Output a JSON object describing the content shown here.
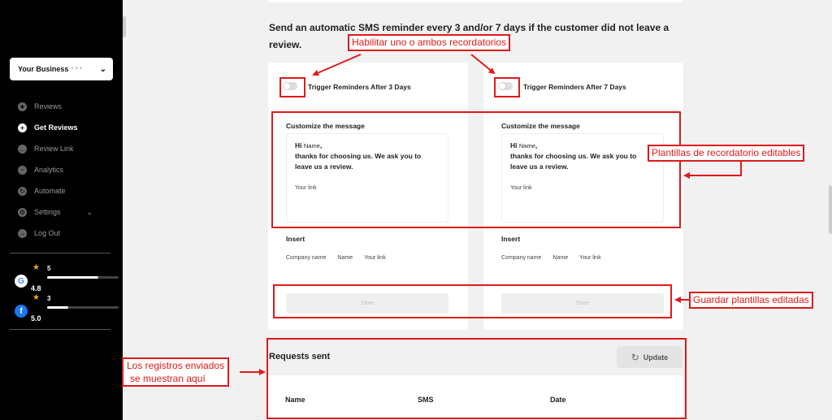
{
  "sidebar": {
    "business_select": {
      "label": "Your Business",
      "masked": "* * *"
    },
    "nav": [
      {
        "label": "Reviews",
        "icon": "star-icon",
        "active": false
      },
      {
        "label": "Get Reviews",
        "icon": "plus-icon",
        "active": true
      },
      {
        "label": "Review Link",
        "icon": "chat-icon",
        "active": false
      },
      {
        "label": "Analytics",
        "icon": "chart-icon",
        "active": false
      },
      {
        "label": "Automate",
        "icon": "automate-icon",
        "active": false
      },
      {
        "label": "Settings",
        "icon": "gear-icon",
        "active": false
      },
      {
        "label": "Log Out",
        "icon": "logout-icon",
        "active": false
      }
    ],
    "ratings": [
      {
        "platform_letter": "G",
        "score": "4.8",
        "count": "5",
        "fill": 0.72
      },
      {
        "platform_letter": "f",
        "score": "5.0",
        "count": "3",
        "fill": 0.3
      }
    ]
  },
  "intro": "Send an automatic SMS reminder every 3 and/or 7 days if the customer did not leave a review.",
  "cards": [
    {
      "toggle_label": "Trigger Reminders After 3 Days",
      "customize_title": "Customize the message",
      "msg_hi": "Hi",
      "msg_name": "Name",
      "msg_body": "thanks for choosing us. We ask you to leave us a review.",
      "msg_link": "Your link",
      "insert_title": "Insert",
      "chips": [
        "Company name",
        "Name",
        "Your link"
      ],
      "save_label": "Save"
    },
    {
      "toggle_label": "Trigger Reminders After 7 Days",
      "customize_title": "Customize the message",
      "msg_hi": "Hi",
      "msg_name": "Name",
      "msg_body": "thanks for choosing us. We ask you to leave us a review.",
      "msg_link": "Your link",
      "insert_title": "Insert",
      "chips": [
        "Company name",
        "Name",
        "Your link"
      ],
      "save_label": "Save"
    }
  ],
  "requests": {
    "title": "Requests sent",
    "update_label": "Update",
    "columns": [
      "Name",
      "SMS",
      "Date"
    ]
  },
  "annotations": {
    "enable": "Habilitar uno o ambos recordatorios",
    "templates": "Plantillas de recordatorio editables",
    "save": "Guardar plantillas editadas",
    "logs_line1": "Los registros enviados",
    "logs_line2": "se muestran aquí"
  },
  "colors": {
    "annotation": "#e01a1a",
    "sidebar_bg": "#000000",
    "page_bg": "#f1f1f1"
  }
}
